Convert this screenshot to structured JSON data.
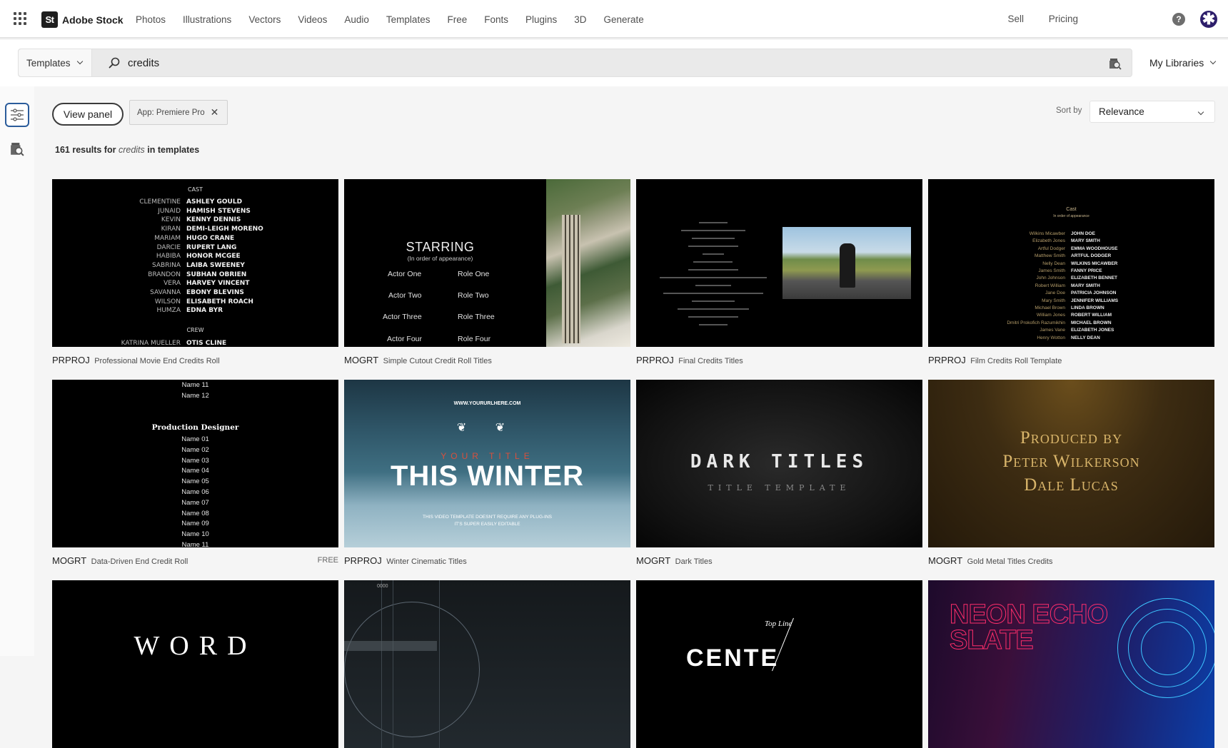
{
  "app": {
    "brand_badge": "St",
    "brand_name": "Adobe Stock"
  },
  "nav": {
    "items": [
      "Photos",
      "Illustrations",
      "Vectors",
      "Videos",
      "Audio",
      "Templates",
      "Free",
      "Fonts",
      "Plugins",
      "3D",
      "Generate"
    ],
    "right": {
      "sell": "Sell",
      "pricing": "Pricing",
      "help_glyph": "?",
      "avatar_glyph": "✱"
    }
  },
  "search": {
    "type_label": "Templates",
    "query": "credits",
    "my_libraries": "My Libraries"
  },
  "toolbar": {
    "view_panel": "View panel",
    "filter_chip": "App: Premiere Pro",
    "chip_close": "✕",
    "sort_label": "Sort by",
    "sort_value": "Relevance"
  },
  "results": {
    "count": "161 results for",
    "query": "credits",
    "suffix": "in templates"
  },
  "cards": [
    {
      "kind": "PRPROJ",
      "title": "Professional Movie End Credits Roll",
      "preview": {
        "cast_heading": "CAST",
        "rows": [
          [
            "CLEMENTINE",
            "ASHLEY GOULD"
          ],
          [
            "JUNAID",
            "HAMISH STEVENS"
          ],
          [
            "KEVIN",
            "KENNY DENNIS"
          ],
          [
            "KIRAN",
            "DEMI-LEIGH MORENO"
          ],
          [
            "MARIAM",
            "HUGO CRANE"
          ],
          [
            "DARCIE",
            "RUPERT LANG"
          ],
          [
            "HABIBA",
            "HONOR MCGEE"
          ],
          [
            "SABRINA",
            "LAIBA SWEENEY"
          ],
          [
            "BRANDON",
            "SUBHAN OBRIEN"
          ],
          [
            "VERA",
            "HARVEY VINCENT"
          ],
          [
            "SAVANNA",
            "EBONY BLEVINS"
          ],
          [
            "WILSON",
            "ELISABETH ROACH"
          ],
          [
            "HUMZA",
            "EDNA BYR"
          ]
        ],
        "crew_heading": "CREW",
        "crew_row": [
          "KATRINA MUELLER",
          "OTIS CLINE"
        ]
      }
    },
    {
      "kind": "MOGRT",
      "title": "Simple Cutout Credit Roll Titles",
      "preview": {
        "heading": "STARRING",
        "subheading": "(In order of appearance)",
        "rows": [
          [
            "Actor One",
            "Role One"
          ],
          [
            "Actor Two",
            "Role Two"
          ],
          [
            "Actor Three",
            "Role Three"
          ],
          [
            "Actor Four",
            "Role Four"
          ]
        ]
      }
    },
    {
      "kind": "PRPROJ",
      "title": "Final Credits Titles"
    },
    {
      "kind": "PRPROJ",
      "title": "Film Credits Roll Template",
      "preview": {
        "heading": "Cast",
        "subheading": "In order of appearance",
        "rows": [
          [
            "Wilkins Micawber",
            "JOHN DOE"
          ],
          [
            "Elizabeth Jones",
            "MARY SMITH"
          ],
          [
            "Artful Dodger",
            "EMMA WOODHOUSE"
          ],
          [
            "Matthew Smith",
            "ARTFUL DODGER"
          ],
          [
            "Nelly Dean",
            "WILKINS MICAWBER"
          ],
          [
            "James Smith",
            "FANNY PRICE"
          ],
          [
            "John Johnson",
            "ELIZABETH BENNET"
          ],
          [
            "Robert William",
            "MARY SMITH"
          ],
          [
            "Jane Doe",
            "PATRICIA JOHNSON"
          ],
          [
            "Mary Smith",
            "JENNIFER WILLIAMS"
          ],
          [
            "Michael Brown",
            "LINDA BROWN"
          ],
          [
            "William Jones",
            "ROBERT WILLIAM"
          ],
          [
            "Dmitri Prokofich Razumikhin",
            "MICHAEL BROWN"
          ],
          [
            "James Vane",
            "ELIZABETH JONES"
          ],
          [
            "Henry Wotton",
            "NELLY DEAN"
          ]
        ]
      }
    },
    {
      "kind": "MOGRT",
      "title": "Data-Driven End Credit Roll",
      "badge": "FREE",
      "preview": {
        "top_names": [
          "Name 11",
          "Name 12"
        ],
        "heading": "Production Designer",
        "names": [
          "Name 01",
          "Name 02",
          "Name 03",
          "Name 04",
          "Name 05",
          "Name 06",
          "Name 07",
          "Name 08",
          "Name 09",
          "Name 10",
          "Name 11"
        ]
      }
    },
    {
      "kind": "PRPROJ",
      "title": "Winter Cinematic Titles",
      "preview": {
        "url": "WWW.YOURURLHERE.COM",
        "laurel": "❦ ❦",
        "your_title": "YOUR TITLE",
        "main": "THIS WINTER",
        "sub1": "THIS VIDEO TEMPLATE DOESN'T REQUIRE ANY PLUG-INS",
        "sub2": "IT'S SUPER EASILY EDITABLE"
      }
    },
    {
      "kind": "MOGRT",
      "title": "Dark Titles",
      "preview": {
        "main": "DARK TITLES",
        "sub": "TITLE TEMPLATE"
      }
    },
    {
      "kind": "MOGRT",
      "title": "Gold Metal Titles Credits",
      "preview": {
        "lines": [
          "Produced by",
          "Peter Wilkerson",
          "Dale Lucas"
        ]
      }
    },
    {
      "preview": {
        "main": "WORD"
      }
    },
    {
      "preview": {
        "dots": "0000"
      }
    },
    {
      "preview": {
        "topline": "Top Line",
        "main": "CENTE"
      }
    },
    {
      "preview": {
        "main": "NEON ECHO SLATE"
      }
    }
  ]
}
